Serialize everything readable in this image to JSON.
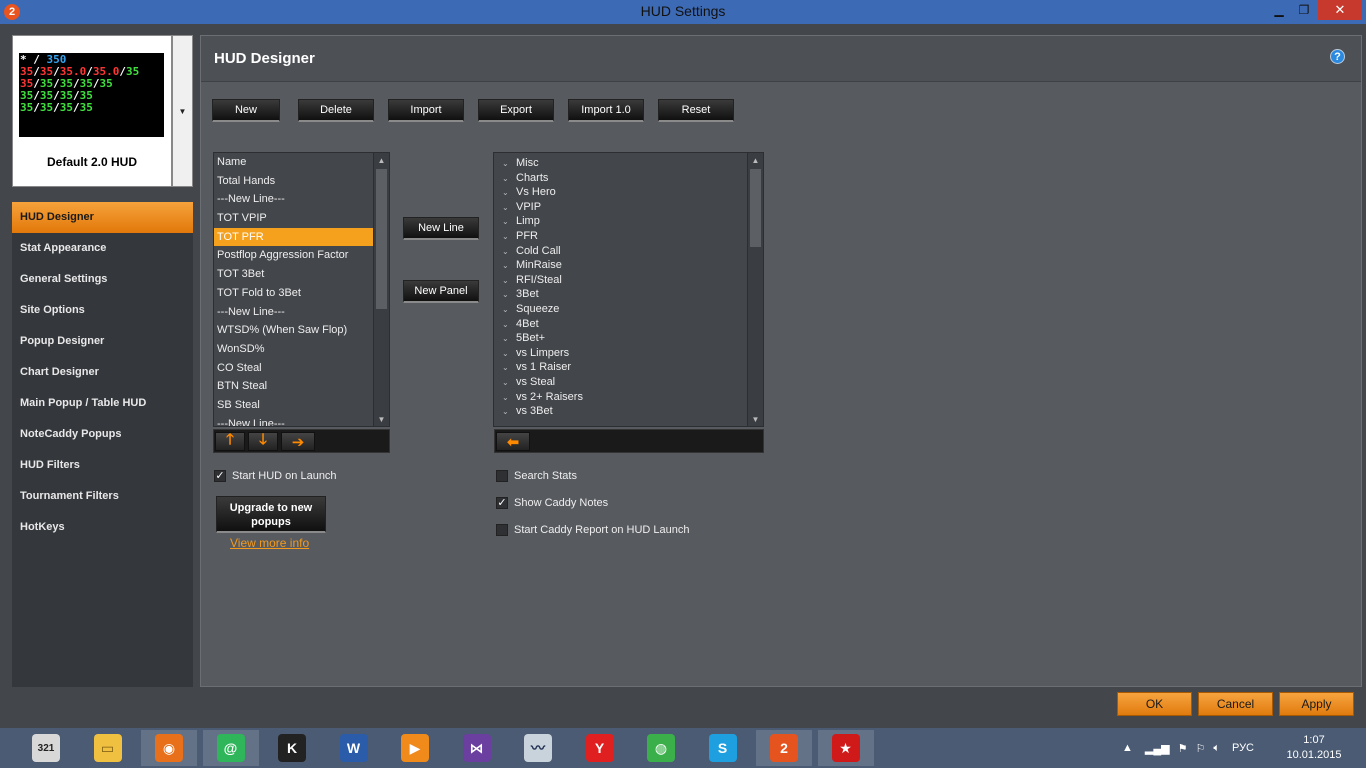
{
  "window": {
    "title": "HUD Settings",
    "app_icon": "2"
  },
  "hud_selector": {
    "name": "Default 2.0 HUD",
    "preview_lines": [
      [
        {
          "t": "* / ",
          "c": "w"
        },
        {
          "t": "350",
          "c": "b"
        }
      ],
      [
        {
          "t": "35",
          "c": "r"
        },
        {
          "t": "/",
          "c": "w"
        },
        {
          "t": "35",
          "c": "r"
        },
        {
          "t": "/",
          "c": "w"
        },
        {
          "t": "35.0",
          "c": "r"
        },
        {
          "t": "/",
          "c": "w"
        },
        {
          "t": "35.0",
          "c": "r"
        },
        {
          "t": "/",
          "c": "w"
        },
        {
          "t": "35",
          "c": "g"
        }
      ],
      [
        {
          "t": "35",
          "c": "r"
        },
        {
          "t": "/",
          "c": "w"
        },
        {
          "t": "35",
          "c": "g"
        },
        {
          "t": "/",
          "c": "w"
        },
        {
          "t": "35",
          "c": "g"
        },
        {
          "t": "/",
          "c": "w"
        },
        {
          "t": "35",
          "c": "g"
        },
        {
          "t": "/",
          "c": "w"
        },
        {
          "t": "35",
          "c": "g"
        }
      ],
      [
        {
          "t": "35",
          "c": "g"
        },
        {
          "t": "/",
          "c": "w"
        },
        {
          "t": "35",
          "c": "g"
        },
        {
          "t": "/",
          "c": "w"
        },
        {
          "t": "35",
          "c": "g"
        },
        {
          "t": "/",
          "c": "w"
        },
        {
          "t": "35",
          "c": "g"
        }
      ],
      [
        {
          "t": "35",
          "c": "g"
        },
        {
          "t": "/",
          "c": "w"
        },
        {
          "t": "35",
          "c": "g"
        },
        {
          "t": "/",
          "c": "w"
        },
        {
          "t": "35",
          "c": "g"
        },
        {
          "t": "/",
          "c": "w"
        },
        {
          "t": "35",
          "c": "g"
        }
      ]
    ]
  },
  "nav": [
    {
      "label": "HUD Designer",
      "active": true
    },
    {
      "label": "Stat Appearance"
    },
    {
      "label": "General Settings"
    },
    {
      "label": "Site Options"
    },
    {
      "label": "Popup Designer"
    },
    {
      "label": "Chart Designer"
    },
    {
      "label": "Main Popup / Table HUD"
    },
    {
      "label": "NoteCaddy Popups"
    },
    {
      "label": "HUD Filters"
    },
    {
      "label": "Tournament Filters"
    },
    {
      "label": "HotKeys"
    }
  ],
  "panel": {
    "title": "HUD Designer"
  },
  "toolbar": {
    "new": "New",
    "delete": "Delete",
    "import": "Import",
    "export": "Export",
    "import10": "Import 1.0",
    "reset": "Reset"
  },
  "hud_lines": [
    "Name",
    "Total Hands",
    "---New Line---",
    "TOT VPIP",
    "TOT PFR",
    "Postflop Aggression Factor",
    "TOT 3Bet",
    "TOT Fold to 3Bet",
    "---New Line---",
    "WTSD% (When Saw Flop)",
    "WonSD%",
    "CO Steal",
    "BTN Steal",
    "SB Steal",
    "---New Line---"
  ],
  "hud_lines_selected_index": 4,
  "middle": {
    "new_line": "New Line",
    "new_panel": "New Panel"
  },
  "stat_categories": [
    "Misc",
    "Charts",
    "Vs Hero",
    "VPIP",
    "Limp",
    "PFR",
    "Cold Call",
    "MinRaise",
    "RFI/Steal",
    "3Bet",
    "Squeeze",
    "4Bet",
    "5Bet+",
    "vs Limpers",
    "vs 1 Raiser",
    "vs Steal",
    "vs 2+ Raisers",
    "vs 3Bet"
  ],
  "options": {
    "start_hud": {
      "label": "Start HUD on Launch",
      "checked": true
    },
    "search_stats": {
      "label": "Search Stats",
      "checked": false
    },
    "show_caddy": {
      "label": "Show Caddy Notes",
      "checked": true
    },
    "caddy_report": {
      "label": "Start Caddy Report on HUD Launch",
      "checked": false
    }
  },
  "upgrade": {
    "line1": "Upgrade to new",
    "line2": "popups",
    "link": "View more info"
  },
  "footer": {
    "ok": "OK",
    "cancel": "Cancel",
    "apply": "Apply"
  },
  "taskbar": {
    "apps": [
      {
        "name": "calendar",
        "glyph": "321",
        "color": "#d8d8d8",
        "fg": "#222"
      },
      {
        "name": "file-explorer",
        "glyph": "▭",
        "color": "#f0c040",
        "fg": "#7a5a10"
      },
      {
        "name": "firefox",
        "glyph": "◉",
        "color": "#e8701a",
        "fg": "#fff"
      },
      {
        "name": "mail",
        "glyph": "@",
        "color": "#2fb55a",
        "fg": "#fff"
      },
      {
        "name": "k-app",
        "glyph": "K",
        "color": "#222",
        "fg": "#fff"
      },
      {
        "name": "word",
        "glyph": "W",
        "color": "#2a5caa",
        "fg": "#fff"
      },
      {
        "name": "media-player",
        "glyph": "▶",
        "color": "#f08a1a",
        "fg": "#fff"
      },
      {
        "name": "visual-studio",
        "glyph": "⋈",
        "color": "#6a3fa0",
        "fg": "#fff"
      },
      {
        "name": "monitor",
        "glyph": "〰",
        "color": "#c9d3dc",
        "fg": "#235"
      },
      {
        "name": "yandex",
        "glyph": "Y",
        "color": "#e02020",
        "fg": "#fff"
      },
      {
        "name": "globe",
        "glyph": "◍",
        "color": "#3bb04a",
        "fg": "#fff"
      },
      {
        "name": "skype",
        "glyph": "S",
        "color": "#1ea0e0",
        "fg": "#fff"
      },
      {
        "name": "holdem-manager",
        "glyph": "2",
        "color": "#e5531f",
        "fg": "#fff"
      },
      {
        "name": "pokerstars",
        "glyph": "★",
        "color": "#d01a1a",
        "fg": "#fff"
      }
    ],
    "lang": "РУС",
    "time": "1:07",
    "date": "10.01.2015"
  }
}
